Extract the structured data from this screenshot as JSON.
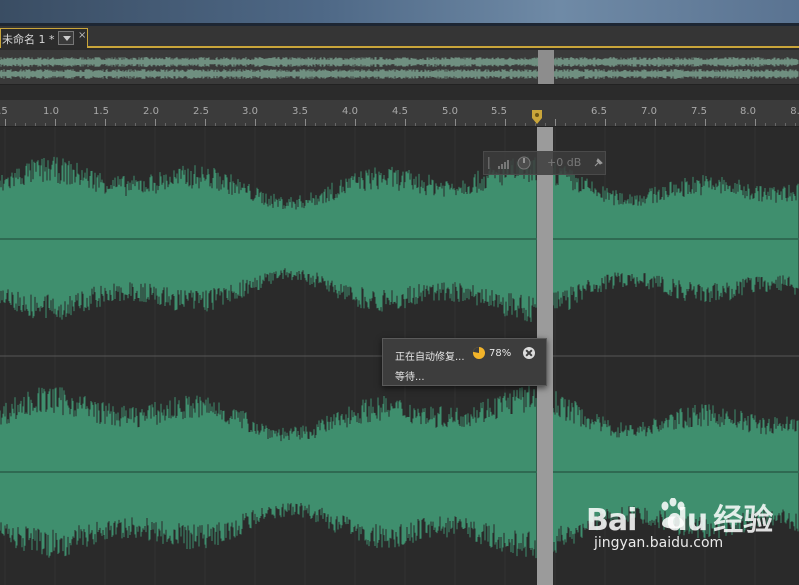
{
  "tab": {
    "title": "未命名 1 *",
    "close_glyph": "×"
  },
  "ruler": {
    "labels": [
      ".5",
      "1.0",
      "1.5",
      "2.0",
      "2.5",
      "3.0",
      "3.5",
      "4.0",
      "4.5",
      "5.0",
      "5.5",
      "6.5",
      "7.0",
      "7.5",
      "8.0",
      "8."
    ]
  },
  "hud": {
    "gain_text": "+0 dB",
    "icons": [
      "level-meter-icon",
      "knob-icon",
      "pin-icon"
    ]
  },
  "progress": {
    "status": "正在自动修复...",
    "percent_text": "78%",
    "percent": 78,
    "waiting": "等待..."
  },
  "watermark": {
    "logo": "Bai",
    "logo2": "du",
    "cn": "经验",
    "url": "jingyan.baidu.com"
  },
  "colors": {
    "waveform": "#3f8f6e",
    "accent": "#c9a53a",
    "playhead": "#9b9b9b"
  }
}
